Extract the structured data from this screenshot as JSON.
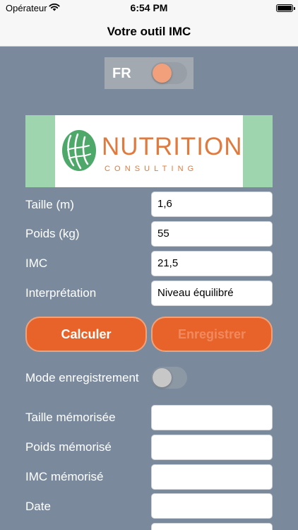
{
  "status_bar": {
    "carrier": "Opérateur",
    "time": "6:54 PM"
  },
  "nav": {
    "title": "Votre outil IMC"
  },
  "language": {
    "label": "FR",
    "toggle_color": "#f2a07b"
  },
  "logo": {
    "word": "NUTRITION",
    "sub": "CONSULTING",
    "brand_color": "#e07a3e",
    "banner_color": "#9ed4ae"
  },
  "form": {
    "taille": {
      "label": "Taille (m)",
      "value": "1,6"
    },
    "poids": {
      "label": "Poids (kg)",
      "value": "55"
    },
    "imc": {
      "label": "IMC",
      "value": "21,5"
    },
    "interpretation": {
      "label": "Interprétation",
      "value": "Niveau équilibré"
    }
  },
  "buttons": {
    "calculer": "Calculer",
    "enregistrer": "Enregistrer",
    "accent_color": "#e8632a"
  },
  "mode": {
    "label": "Mode enregistrement"
  },
  "memorised": {
    "taille": {
      "label": "Taille mémorisée",
      "value": ""
    },
    "poids": {
      "label": "Poids mémorisé",
      "value": ""
    },
    "imc": {
      "label": "IMC mémorisé",
      "value": ""
    },
    "date": {
      "label": "Date",
      "value": ""
    }
  }
}
